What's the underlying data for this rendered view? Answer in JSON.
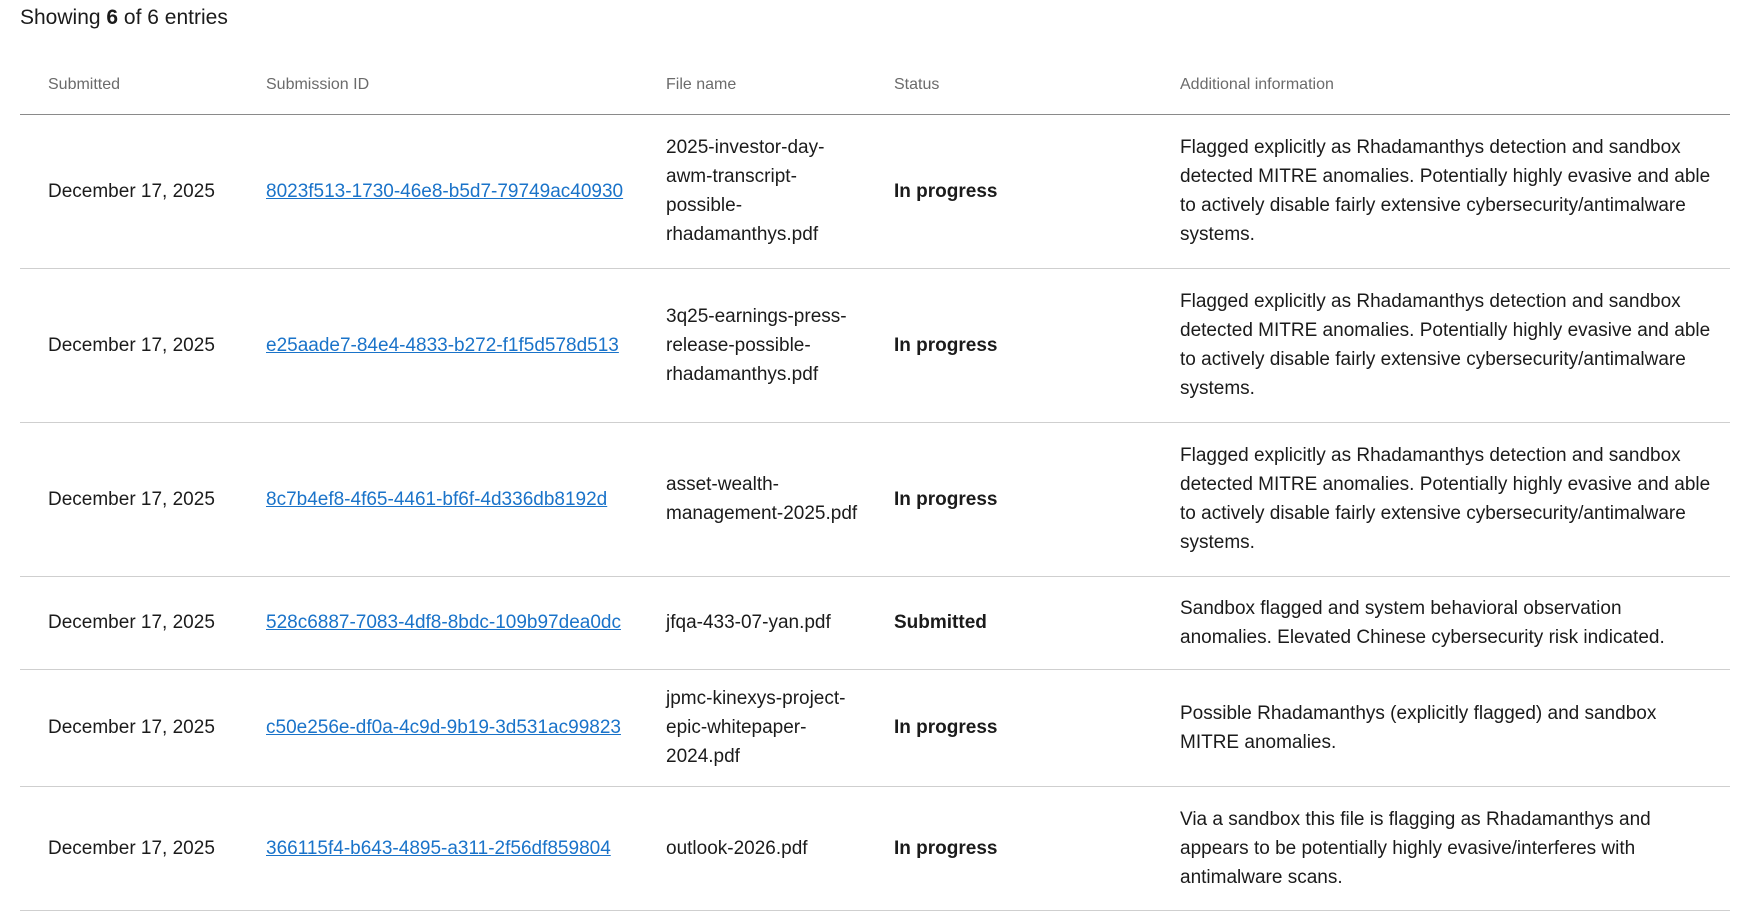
{
  "summary": {
    "prefix": "Showing ",
    "shown": "6",
    "middle": " of ",
    "total": "6",
    "suffix": " entries"
  },
  "table": {
    "headers": {
      "submitted": "Submitted",
      "submission_id": "Submission ID",
      "file_name": "File name",
      "status": "Status",
      "additional_information": "Additional information"
    },
    "rows": [
      {
        "submitted": "December 17, 2025",
        "submission_id": "8023f513-1730-46e8-b5d7-79749ac40930",
        "file_name": "2025-investor-day-awm-transcript-possible-rhadamanthys.pdf",
        "status": "In progress",
        "info": "Flagged explicitly as Rhadamanthys detection and sandbox detected MITRE anomalies. Potentially highly evasive and able to actively disable fairly extensive cybersecurity/antimalware systems."
      },
      {
        "submitted": "December 17, 2025",
        "submission_id": "e25aade7-84e4-4833-b272-f1f5d578d513",
        "file_name": "3q25-earnings-press-release-possible-rhadamanthys.pdf",
        "status": "In progress",
        "info": "Flagged explicitly as Rhadamanthys detection and sandbox detected MITRE anomalies. Potentially highly evasive and able to actively disable fairly extensive cybersecurity/antimalware systems."
      },
      {
        "submitted": "December 17, 2025",
        "submission_id": "8c7b4ef8-4f65-4461-bf6f-4d336db8192d",
        "file_name": "asset-wealth-management-2025.pdf",
        "status": "In progress",
        "info": "Flagged explicitly as Rhadamanthys detection and sandbox detected MITRE anomalies. Potentially highly evasive and able to actively disable fairly extensive cybersecurity/antimalware systems."
      },
      {
        "submitted": "December 17, 2025",
        "submission_id": "528c6887-7083-4df8-8bdc-109b97dea0dc",
        "file_name": "jfqa-433-07-yan.pdf",
        "status": "Submitted",
        "info": "Sandbox flagged and system behavioral observation anomalies. Elevated Chinese cybersecurity risk indicated."
      },
      {
        "submitted": "December 17, 2025",
        "submission_id": "c50e256e-df0a-4c9d-9b19-3d531ac99823",
        "file_name": "jpmc-kinexys-project-epic-whitepaper-2024.pdf",
        "status": "In progress",
        "info": "Possible Rhadamanthys (explicitly flagged) and sandbox MITRE anomalies."
      },
      {
        "submitted": "December 17, 2025",
        "submission_id": "366115f4-b643-4895-a311-2f56df859804",
        "file_name": "outlook-2026.pdf",
        "status": "In progress",
        "info": "Via a sandbox this file is flagging as Rhadamanthys and appears to be potentially highly evasive/interferes with antimalware scans."
      }
    ]
  }
}
